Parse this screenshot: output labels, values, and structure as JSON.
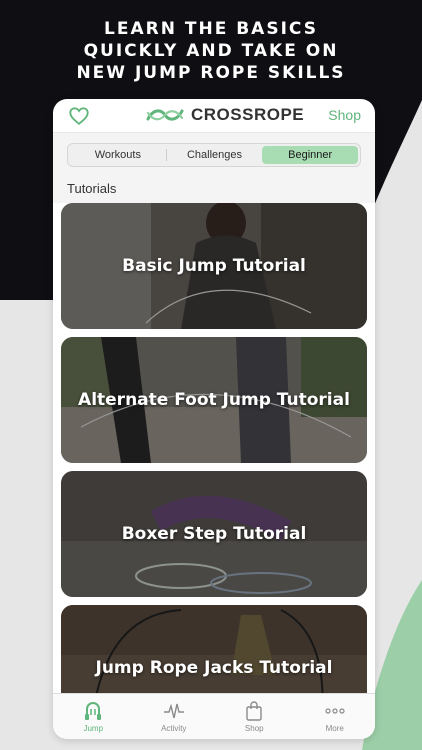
{
  "headline": [
    "LEARN THE BASICS",
    "QUICKLY AND TAKE ON",
    "NEW JUMP ROPE SKILLS"
  ],
  "brand": {
    "name": "CROSSROPE",
    "accent": "#5fb57b"
  },
  "header": {
    "shop_label": "Shop",
    "left_icon": "heart-icon"
  },
  "segments": {
    "items": [
      "Workouts",
      "Challenges",
      "Beginner"
    ],
    "selected": "Beginner"
  },
  "section_title": "Tutorials",
  "tutorials": [
    {
      "title": "Basic Jump Tutorial"
    },
    {
      "title": "Alternate Foot Jump Tutorial"
    },
    {
      "title": "Boxer Step Tutorial"
    },
    {
      "title": "Jump Rope Jacks Tutorial"
    }
  ],
  "tabbar": {
    "items": [
      {
        "label": "Jump",
        "icon": "jump-rope-icon"
      },
      {
        "label": "Activity",
        "icon": "activity-icon"
      },
      {
        "label": "Shop",
        "icon": "shopping-bag-icon"
      },
      {
        "label": "More",
        "icon": "more-dots-icon"
      }
    ],
    "active": "Jump"
  }
}
